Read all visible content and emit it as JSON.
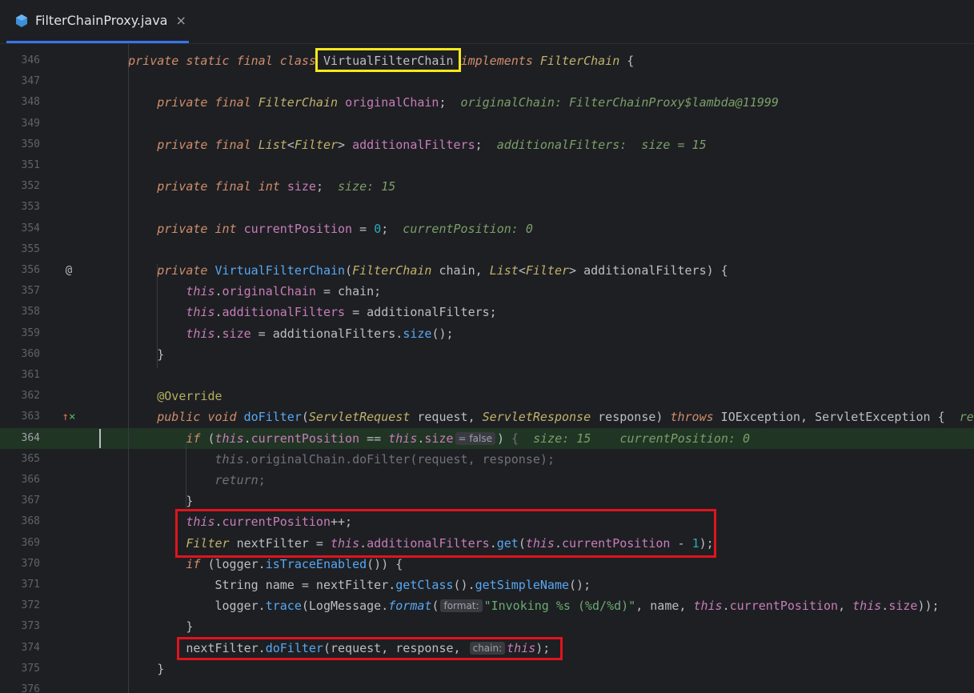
{
  "tab": {
    "title": "FilterChainProxy.java",
    "close": "×"
  },
  "lines": [
    {
      "n": "346",
      "icon": "",
      "code": "    private static final class VirtualFilterChain implements FilterChain {"
    },
    {
      "n": "347",
      "icon": "",
      "code": ""
    },
    {
      "n": "348",
      "icon": "",
      "code": "        private final FilterChain originalChain;  originalChain: FilterChainProxy$lambda@11999"
    },
    {
      "n": "349",
      "icon": "",
      "code": ""
    },
    {
      "n": "350",
      "icon": "",
      "code": "        private final List<Filter> additionalFilters;  additionalFilters:  size = 15"
    },
    {
      "n": "351",
      "icon": "",
      "code": ""
    },
    {
      "n": "352",
      "icon": "",
      "code": "        private final int size;  size: 15"
    },
    {
      "n": "353",
      "icon": "",
      "code": ""
    },
    {
      "n": "354",
      "icon": "",
      "code": "        private int currentPosition = 0;  currentPosition: 0"
    },
    {
      "n": "355",
      "icon": "",
      "code": ""
    },
    {
      "n": "356",
      "icon": "@",
      "code": "        private VirtualFilterChain(FilterChain chain, List<Filter> additionalFilters) {"
    },
    {
      "n": "357",
      "icon": "",
      "code": "            this.originalChain = chain;"
    },
    {
      "n": "358",
      "icon": "",
      "code": "            this.additionalFilters = additionalFilters;"
    },
    {
      "n": "359",
      "icon": "",
      "code": "            this.size = additionalFilters.size();"
    },
    {
      "n": "360",
      "icon": "",
      "code": "        }"
    },
    {
      "n": "361",
      "icon": "",
      "code": ""
    },
    {
      "n": "362",
      "icon": "",
      "code": "        @Override"
    },
    {
      "n": "363",
      "icon": "override",
      "code": "        public void doFilter(ServletRequest request, ServletResponse response) throws IOException, ServletException {  rec"
    },
    {
      "n": "364",
      "icon": "",
      "code": "            if (this.currentPosition == this.size = false ) {  size: 15    currentPosition: 0"
    },
    {
      "n": "365",
      "icon": "",
      "code": "                this.originalChain.doFilter(request, response);"
    },
    {
      "n": "366",
      "icon": "",
      "code": "                return;"
    },
    {
      "n": "367",
      "icon": "",
      "code": "            }"
    },
    {
      "n": "368",
      "icon": "",
      "code": "            this.currentPosition++;"
    },
    {
      "n": "369",
      "icon": "",
      "code": "            Filter nextFilter = this.additionalFilters.get(this.currentPosition - 1);"
    },
    {
      "n": "370",
      "icon": "",
      "code": "            if (logger.isTraceEnabled()) {"
    },
    {
      "n": "371",
      "icon": "",
      "code": "                String name = nextFilter.getClass().getSimpleName();"
    },
    {
      "n": "372",
      "icon": "",
      "code": "                logger.trace(LogMessage.format( format: \"Invoking %s (%d/%d)\", name, this.currentPosition, this.size));"
    },
    {
      "n": "373",
      "icon": "",
      "code": "            }"
    },
    {
      "n": "374",
      "icon": "",
      "code": "            nextFilter.doFilter(request, response,  chain: this);"
    },
    {
      "n": "375",
      "icon": "",
      "code": "        }"
    },
    {
      "n": "376",
      "icon": "",
      "code": ""
    }
  ],
  "current_line": "364",
  "inline_hints": {
    "cond_value": "= false",
    "format_param": "format:",
    "chain_param": "chain:"
  },
  "colors": {
    "highlight_class": "#f5e91d",
    "highlight_box": "#e0141e",
    "current_line_bg": "#213524"
  }
}
